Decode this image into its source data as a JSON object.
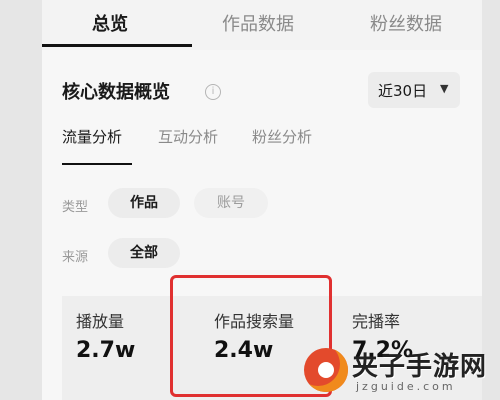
{
  "top_tabs": [
    {
      "label": "总览",
      "active": true
    },
    {
      "label": "作品数据",
      "active": false
    },
    {
      "label": "粉丝数据",
      "active": false
    }
  ],
  "section": {
    "title": "核心数据概览",
    "info_icon": "info-circle-icon",
    "date_range": {
      "label": "近30日",
      "icon": "caret-down-icon"
    }
  },
  "sub_tabs": [
    {
      "label": "流量分析",
      "active": true
    },
    {
      "label": "互动分析",
      "active": false
    },
    {
      "label": "粉丝分析",
      "active": false
    }
  ],
  "filters": {
    "type": {
      "label": "类型",
      "options": [
        {
          "label": "作品",
          "selected": true
        },
        {
          "label": "账号",
          "selected": false
        }
      ]
    },
    "source": {
      "label": "来源",
      "options": [
        {
          "label": "全部",
          "selected": true
        }
      ]
    }
  },
  "metrics": [
    {
      "label": "播放量",
      "value": "2.7w"
    },
    {
      "label": "作品搜索量",
      "value": "2.4w",
      "highlighted": true
    },
    {
      "label": "完播率",
      "value": "7.2%"
    }
  ],
  "highlight_color": "#e03030",
  "watermark": {
    "text": "夹子手游网",
    "url": "jzguide.com"
  }
}
